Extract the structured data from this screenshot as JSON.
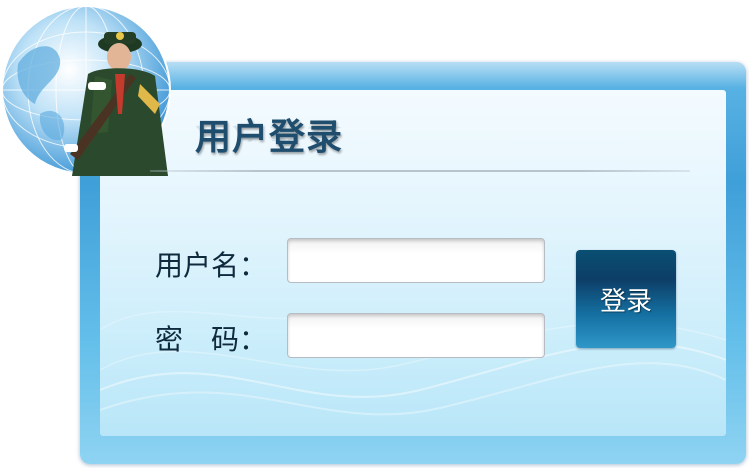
{
  "login": {
    "title": "用户登录",
    "username_label": "用户名：",
    "password_label": "密　码：",
    "username_value": "",
    "password_value": "",
    "submit_label": "登录"
  },
  "colors": {
    "frame_blue": "#3f9fd8",
    "title_text": "#1e4d6e",
    "button_dark": "#0d3e67",
    "button_light": "#2f97c9"
  },
  "icons": {
    "emblem": "globe-with-soldier-icon"
  }
}
